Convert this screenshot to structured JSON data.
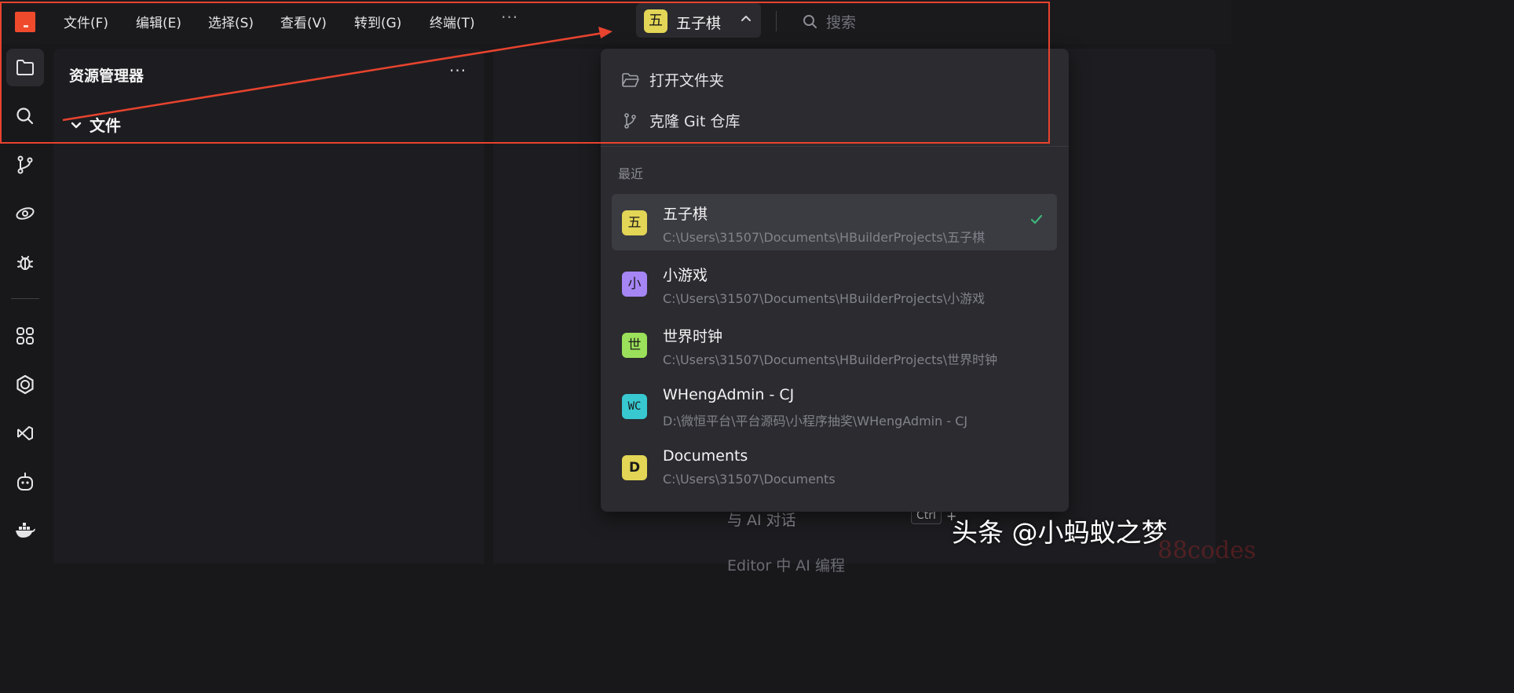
{
  "menu": {
    "items": [
      {
        "label": "文件(F)",
        "name": "menu-file"
      },
      {
        "label": "编辑(E)",
        "name": "menu-edit"
      },
      {
        "label": "选择(S)",
        "name": "menu-select"
      },
      {
        "label": "查看(V)",
        "name": "menu-view"
      },
      {
        "label": "转到(G)",
        "name": "menu-goto"
      },
      {
        "label": "终端(T)",
        "name": "menu-terminal"
      }
    ],
    "more": "···"
  },
  "project": {
    "badge": "五",
    "name": "五子棋",
    "badge_color": "#e3d556"
  },
  "search": {
    "placeholder": "搜索"
  },
  "sidebar": {
    "title": "资源管理器",
    "more": "···",
    "section": "文件"
  },
  "dropdown": {
    "actions": [
      {
        "label": "打开文件夹",
        "icon": "folder-open-icon"
      },
      {
        "label": "克隆 Git 仓库",
        "icon": "git-branch-icon"
      }
    ],
    "recent_label": "最近",
    "recent": [
      {
        "badge": "五",
        "name": "五子棋",
        "path": "C:\\Users\\31507\\Documents\\HBuilderProjects\\五子棋",
        "color": "#e3d556",
        "selected": true
      },
      {
        "badge": "小",
        "name": "小游戏",
        "path": "C:\\Users\\31507\\Documents\\HBuilderProjects\\小游戏",
        "color": "#a685f5",
        "selected": false
      },
      {
        "badge": "世",
        "name": "世界时钟",
        "path": "C:\\Users\\31507\\Documents\\HBuilderProjects\\世界时钟",
        "color": "#9be05a",
        "selected": false
      },
      {
        "badge": "WC",
        "name": "WHengAdmin - CJ",
        "path": "D:\\微恒平台\\平台源码\\小程序抽奖\\WHengAdmin - CJ",
        "color": "#38c8d0",
        "selected": false
      },
      {
        "badge": "D",
        "name": "Documents",
        "path": "C:\\Users\\31507\\Documents",
        "color": "#e3d556",
        "selected": false
      }
    ]
  },
  "editor": {
    "hint": "与 AI 对话",
    "shortcut_key": "Ctrl",
    "shortcut_plus": "+",
    "hint2": "Editor 中 AI 编程"
  },
  "watermark": {
    "text": "头条 @小蚂蚁之梦",
    "sub": "88codes"
  },
  "colors": {
    "accent": "#ef4a2c",
    "annotation": "#e8432e",
    "check": "#3fb67a"
  }
}
